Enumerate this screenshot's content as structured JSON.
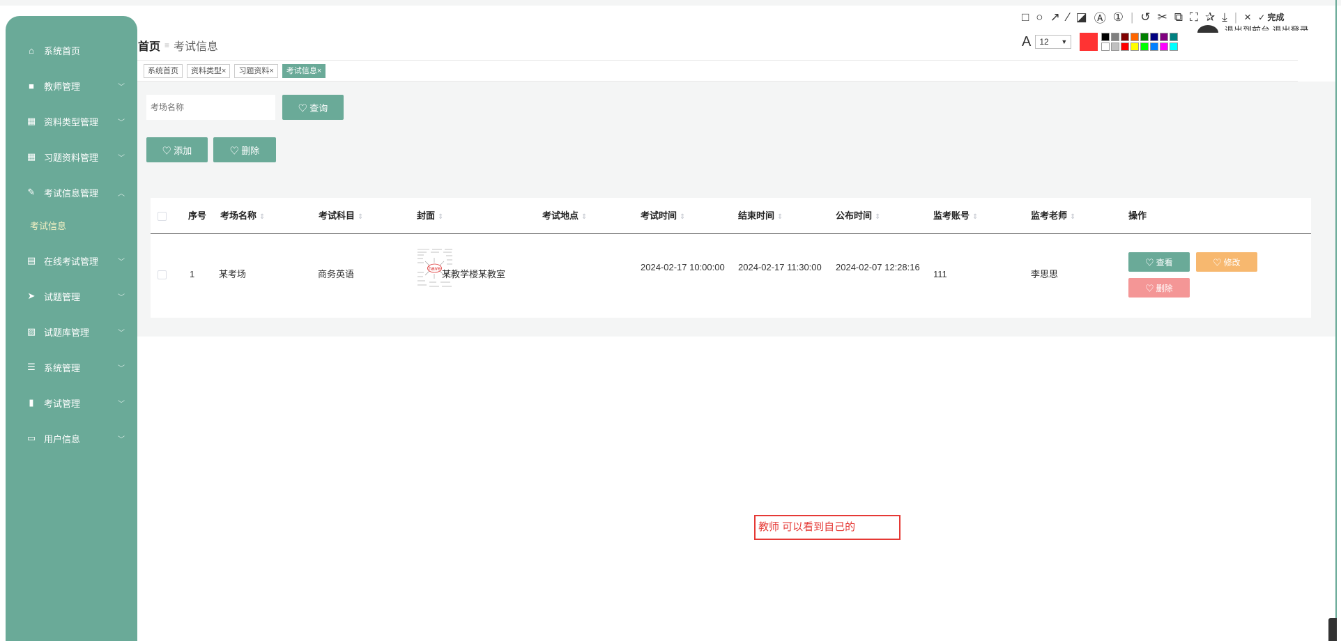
{
  "sidebar": {
    "items": [
      {
        "label": "系统首页",
        "icon": "home-icon",
        "glyph": "⌂",
        "has_chevron": false
      },
      {
        "label": "教师管理",
        "icon": "monitor-icon",
        "glyph": "■",
        "has_chevron": true
      },
      {
        "label": "资料类型管理",
        "icon": "grid-icon",
        "glyph": "▦",
        "has_chevron": true
      },
      {
        "label": "习题资料管理",
        "icon": "grid-icon",
        "glyph": "▦",
        "has_chevron": true
      },
      {
        "label": "考试信息管理",
        "icon": "pen-icon",
        "glyph": "✎",
        "has_chevron": true,
        "expanded": true
      },
      {
        "label": "考试信息",
        "sub": true
      },
      {
        "label": "在线考试管理",
        "icon": "clipboard-icon",
        "glyph": "▤",
        "has_chevron": true
      },
      {
        "label": "试题管理",
        "icon": "send-icon",
        "glyph": "➤",
        "has_chevron": true
      },
      {
        "label": "试题库管理",
        "icon": "image-icon",
        "glyph": "▨",
        "has_chevron": true
      },
      {
        "label": "系统管理",
        "icon": "menu-icon",
        "glyph": "☰",
        "has_chevron": true
      },
      {
        "label": "考试管理",
        "icon": "bar-chart-icon",
        "glyph": "▮",
        "has_chevron": true
      },
      {
        "label": "用户信息",
        "icon": "window-icon",
        "glyph": "▭",
        "has_chevron": true
      }
    ],
    "chevron_down": "﹀",
    "chevron_up": "︿"
  },
  "breadcrumb": {
    "home": "首页",
    "separator": "≡",
    "current": "考试信息"
  },
  "tabs": [
    {
      "label": "系统首页",
      "closable": false
    },
    {
      "label": "资料类型×",
      "closable": true
    },
    {
      "label": "习题资料×",
      "closable": true
    },
    {
      "label": "考试信息×",
      "closable": true,
      "active": true
    }
  ],
  "search": {
    "placeholder": "考场名称",
    "query_label": "♡ 查询"
  },
  "actions": {
    "add_label": "♡ 添加",
    "delete_label": "♡ 删除"
  },
  "table": {
    "headers": {
      "index": "序号",
      "name": "考场名称",
      "subject": "考试科目",
      "cover": "封面",
      "location": "考试地点",
      "start": "考试时间",
      "end": "结束时间",
      "publish": "公布时间",
      "proctor_account": "监考账号",
      "proctor_teacher": "监考老师",
      "ops": "操作"
    },
    "sort_glyph": "⇕",
    "rows": [
      {
        "index": "1",
        "name": "某考场",
        "subject": "商务英语",
        "cover_word": "have",
        "location": "某教学楼某教室",
        "start": "2024-02-17 10:00:00",
        "end": "2024-02-17 11:30:00",
        "publish": "2024-02-07 12:28:16",
        "proctor_account": "111",
        "proctor_teacher": "李思思",
        "view_label": "♡ 查看",
        "edit_label": "♡ 修改",
        "delete_label": "♡ 删除"
      }
    ]
  },
  "annotation": {
    "text": "教师 可以看到自己的"
  },
  "screenshot_toolbar": {
    "tools": [
      "□",
      "○",
      "↗",
      "∕",
      "◪",
      "Ⓐ",
      "①",
      "↺",
      "✂",
      "⧉",
      "⛶",
      "✰",
      "⤓"
    ],
    "close": "×",
    "done_label": "✓ 完成",
    "font_glyph": "A",
    "font_size": "12",
    "dropdown_glyph": "▼",
    "current_color": "#ff3333",
    "palette": [
      "#000000",
      "#808080",
      "#800000",
      "#ff6600",
      "#008000",
      "#000080",
      "#800080",
      "#008080",
      "#ffffff",
      "#c0c0c0",
      "#ff0000",
      "#ffff00",
      "#00ff00",
      "#0080ff",
      "#ff00ff",
      "#00ffff"
    ]
  },
  "user": {
    "links": "退出到前台 退出登录"
  },
  "colors": {
    "brand": "#6aaa98",
    "warning": "#f7b86f",
    "danger": "#f49696",
    "annotation": "#e53935"
  }
}
